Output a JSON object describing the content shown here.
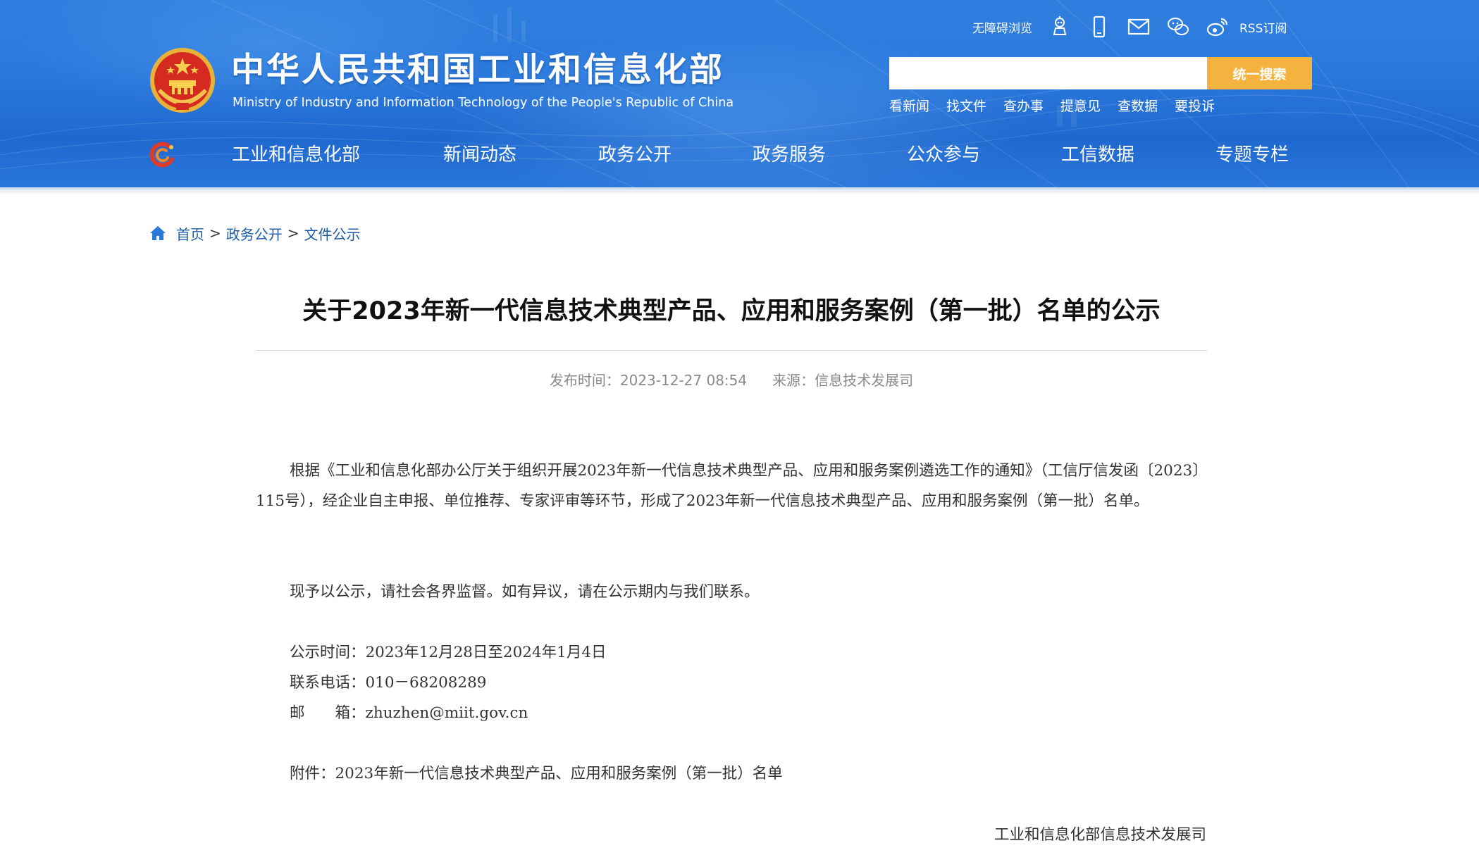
{
  "header": {
    "site_title_cn": "中华人民共和国工业和信息化部",
    "site_title_en": "Ministry of Industry and Information Technology of the People's Republic of China",
    "top_links": {
      "accessibility": "无障碍浏览",
      "rss": "RSS订阅"
    },
    "top_icons": [
      "robot-icon",
      "mobile-icon",
      "mail-icon",
      "wechat-icon",
      "weibo-icon"
    ],
    "search": {
      "placeholder": "",
      "button_label": "统一搜索"
    },
    "quick_links": [
      "看新闻",
      "找文件",
      "查办事",
      "提意见",
      "查数据",
      "要投诉"
    ],
    "nav": [
      "工业和信息化部",
      "新闻动态",
      "政务公开",
      "政务服务",
      "公众参与",
      "工信数据",
      "专题专栏"
    ],
    "colors": {
      "header_blue": "#2a78dc",
      "search_button": "#f4b23f"
    }
  },
  "breadcrumb": [
    "首页",
    "政务公开",
    "文件公示"
  ],
  "article": {
    "title": "关于2023年新一代信息技术典型产品、应用和服务案例（第一批）名单的公示",
    "publish_label": "发布时间：",
    "publish_time": "2023-12-27 08:54",
    "source_label": "来源：",
    "source": "信息技术发展司",
    "paragraph1": "根据《工业和信息化部办公厅关于组织开展2023年新一代信息技术典型产品、应用和服务案例遴选工作的通知》（工信厅信发函〔2023〕115号），经企业自主申报、单位推荐、专家评审等环节，形成了2023年新一代信息技术典型产品、应用和服务案例（第一批）名单。",
    "paragraph2": "现予以公示，请社会各界监督。如有异议，请在公示期内与我们联系。",
    "notice_period": "公示时间：2023年12月28日至2024年1月4日",
    "phone": "联系电话：010－68208289",
    "email": "邮　　箱：zhuzhen@miit.gov.cn",
    "attachment": "附件：2023年新一代信息技术典型产品、应用和服务案例（第一批）名单",
    "signature": "工业和信息化部信息技术发展司"
  }
}
